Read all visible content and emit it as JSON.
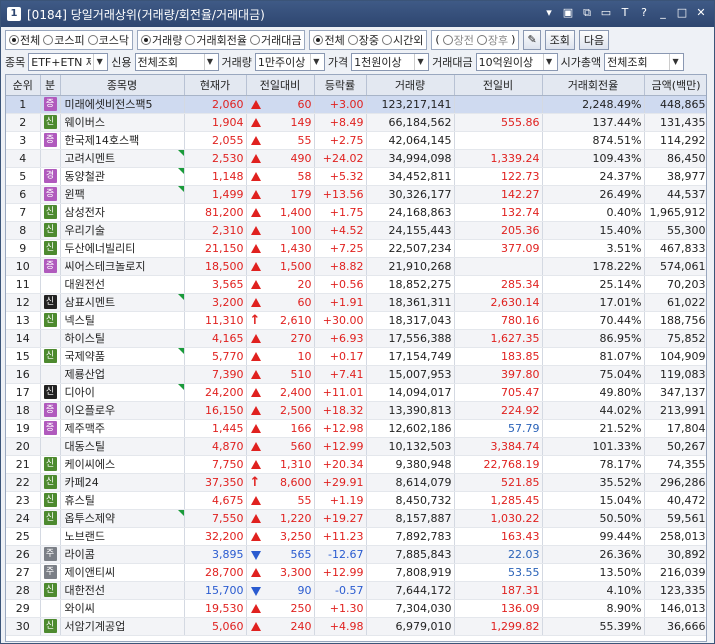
{
  "window": {
    "num": "1",
    "title": "[0184] 당일거래상위(거래량/회전율/거래대금)"
  },
  "toolbar": {
    "market": [
      "전체",
      "코스피",
      "코스닥"
    ],
    "market_sel": 0,
    "basis": [
      "거래량",
      "거래회전율",
      "거래대금"
    ],
    "basis_sel": 0,
    "session": [
      "전체",
      "장중",
      "시간외"
    ],
    "session_sel": 0,
    "timeopt": [
      "장전",
      "장후"
    ],
    "query_label": "조회",
    "next_label": "다음"
  },
  "filters": {
    "jongmok_label": "종목",
    "jongmok_val": "ETF+ETN 제",
    "credit_label": "신용",
    "credit_val": "전체조회",
    "volume_label": "거래량",
    "volume_val": "1만주이상",
    "price_label": "가격",
    "price_val": "1천원이상",
    "amount_label": "거래대금",
    "amount_val": "10억원이상",
    "cap_label": "시가총액",
    "cap_val": "전체조회"
  },
  "columns": [
    "순위",
    "분",
    "종목명",
    "현재가",
    "전일대비",
    "등락률",
    "거래량",
    "전일비",
    "거래회전율",
    "금액(백만)"
  ],
  "rows": [
    {
      "rank": "1",
      "badge": "증",
      "bt": "gyeong",
      "name": "미래에셋비전스팩5",
      "price": "2,060",
      "dir": "up",
      "change": "60",
      "rate": "+3.00",
      "vol": "123,217,141",
      "prev": "",
      "turn": "2,248.49%",
      "amt": "448,865",
      "flag": false,
      "hl": true
    },
    {
      "rank": "2",
      "badge": "신",
      "bt": "sin",
      "name": "웨이버스",
      "price": "1,904",
      "dir": "up",
      "change": "149",
      "rate": "+8.49",
      "vol": "66,184,562",
      "prev": "555.86",
      "turn": "137.44%",
      "amt": "131,435",
      "flag": false
    },
    {
      "rank": "3",
      "badge": "증",
      "bt": "gyeong",
      "name": "한국제14호스팩",
      "price": "2,055",
      "dir": "up",
      "change": "55",
      "rate": "+2.75",
      "vol": "42,064,145",
      "prev": "",
      "turn": "874.51%",
      "amt": "114,292",
      "flag": false
    },
    {
      "rank": "4",
      "badge": "",
      "bt": "",
      "name": "고려시멘트",
      "price": "2,530",
      "dir": "up",
      "change": "490",
      "rate": "+24.02",
      "vol": "34,994,098",
      "prev": "1,339.24",
      "turn": "109.43%",
      "amt": "86,450",
      "flag": true
    },
    {
      "rank": "5",
      "badge": "경",
      "bt": "gyeong",
      "name": "동양철관",
      "price": "1,148",
      "dir": "up",
      "change": "58",
      "rate": "+5.32",
      "vol": "34,452,811",
      "prev": "122.73",
      "turn": "24.37%",
      "amt": "38,977",
      "flag": true
    },
    {
      "rank": "6",
      "badge": "증",
      "bt": "gyeong",
      "name": "윈팩",
      "price": "1,499",
      "dir": "up",
      "change": "179",
      "rate": "+13.56",
      "vol": "30,326,177",
      "prev": "142.27",
      "turn": "26.49%",
      "amt": "44,537",
      "flag": true
    },
    {
      "rank": "7",
      "badge": "신",
      "bt": "sin",
      "name": "삼성전자",
      "price": "81,200",
      "dir": "up",
      "change": "1,400",
      "rate": "+1.75",
      "vol": "24,168,863",
      "prev": "132.74",
      "turn": "0.40%",
      "amt": "1,965,912",
      "flag": false
    },
    {
      "rank": "8",
      "badge": "신",
      "bt": "sin",
      "name": "우리기술",
      "price": "2,310",
      "dir": "up",
      "change": "100",
      "rate": "+4.52",
      "vol": "24,155,443",
      "prev": "205.36",
      "turn": "15.40%",
      "amt": "55,300",
      "flag": false
    },
    {
      "rank": "9",
      "badge": "신",
      "bt": "sin",
      "name": "두산에너빌리티",
      "price": "21,150",
      "dir": "up",
      "change": "1,430",
      "rate": "+7.25",
      "vol": "22,507,234",
      "prev": "377.09",
      "turn": "3.51%",
      "amt": "467,833",
      "flag": false
    },
    {
      "rank": "10",
      "badge": "증",
      "bt": "gyeong",
      "name": "씨어스테크놀로지",
      "price": "18,500",
      "dir": "up",
      "change": "1,500",
      "rate": "+8.82",
      "vol": "21,910,268",
      "prev": "",
      "turn": "178.22%",
      "amt": "574,061",
      "flag": false
    },
    {
      "rank": "11",
      "badge": "",
      "bt": "",
      "name": "대원전선",
      "price": "3,565",
      "dir": "up",
      "change": "20",
      "rate": "+0.56",
      "vol": "18,852,275",
      "prev": "285.34",
      "turn": "25.14%",
      "amt": "70,203",
      "flag": false
    },
    {
      "rank": "12",
      "badge": "신",
      "bt": "sinb",
      "name": "삼표시멘트",
      "price": "3,200",
      "dir": "up",
      "change": "60",
      "rate": "+1.91",
      "vol": "18,361,311",
      "prev": "2,630.14",
      "turn": "17.01%",
      "amt": "61,022",
      "flag": true
    },
    {
      "rank": "13",
      "badge": "신",
      "bt": "sin",
      "name": "넥스틸",
      "price": "11,310",
      "dir": "upper",
      "change": "2,610",
      "rate": "+30.00",
      "vol": "18,317,043",
      "prev": "780.16",
      "turn": "70.44%",
      "amt": "188,756",
      "flag": false
    },
    {
      "rank": "14",
      "badge": "",
      "bt": "",
      "name": "하이스틸",
      "price": "4,165",
      "dir": "up",
      "change": "270",
      "rate": "+6.93",
      "vol": "17,556,388",
      "prev": "1,627.35",
      "turn": "86.95%",
      "amt": "75,852",
      "flag": false
    },
    {
      "rank": "15",
      "badge": "신",
      "bt": "sin",
      "name": "국제약품",
      "price": "5,770",
      "dir": "up",
      "change": "10",
      "rate": "+0.17",
      "vol": "17,154,749",
      "prev": "183.85",
      "turn": "81.07%",
      "amt": "104,909",
      "flag": true
    },
    {
      "rank": "16",
      "badge": "",
      "bt": "",
      "name": "제룡산업",
      "price": "7,390",
      "dir": "up",
      "change": "510",
      "rate": "+7.41",
      "vol": "15,007,953",
      "prev": "397.80",
      "turn": "75.04%",
      "amt": "119,083",
      "flag": false
    },
    {
      "rank": "17",
      "badge": "신",
      "bt": "sinb",
      "name": "디아이",
      "price": "24,200",
      "dir": "up",
      "change": "2,400",
      "rate": "+11.01",
      "vol": "14,094,017",
      "prev": "705.47",
      "turn": "49.80%",
      "amt": "347,137",
      "flag": true
    },
    {
      "rank": "18",
      "badge": "증",
      "bt": "gyeong",
      "name": "이오플로우",
      "price": "16,150",
      "dir": "up",
      "change": "2,500",
      "rate": "+18.32",
      "vol": "13,390,813",
      "prev": "224.92",
      "turn": "44.02%",
      "amt": "213,991",
      "flag": false
    },
    {
      "rank": "19",
      "badge": "증",
      "bt": "gyeong",
      "name": "제주맥주",
      "price": "1,445",
      "dir": "up",
      "change": "166",
      "rate": "+12.98",
      "vol": "12,602,186",
      "prev": "57.79",
      "turn": "21.52%",
      "amt": "17,804",
      "flag": false,
      "prevblue": true
    },
    {
      "rank": "20",
      "badge": "",
      "bt": "",
      "name": "대동스틸",
      "price": "4,870",
      "dir": "up",
      "change": "560",
      "rate": "+12.99",
      "vol": "10,132,503",
      "prev": "3,384.74",
      "turn": "101.33%",
      "amt": "50,267",
      "flag": false
    },
    {
      "rank": "21",
      "badge": "신",
      "bt": "sin",
      "name": "케이씨에스",
      "price": "7,750",
      "dir": "up",
      "change": "1,310",
      "rate": "+20.34",
      "vol": "9,380,948",
      "prev": "22,768.19",
      "turn": "78.17%",
      "amt": "74,355",
      "flag": false
    },
    {
      "rank": "22",
      "badge": "신",
      "bt": "sin",
      "name": "카페24",
      "price": "37,350",
      "dir": "upper",
      "change": "8,600",
      "rate": "+29.91",
      "vol": "8,614,079",
      "prev": "521.85",
      "turn": "35.52%",
      "amt": "296,286",
      "flag": false
    },
    {
      "rank": "23",
      "badge": "신",
      "bt": "sin",
      "name": "휴스틸",
      "price": "4,675",
      "dir": "up",
      "change": "55",
      "rate": "+1.19",
      "vol": "8,450,732",
      "prev": "1,285.45",
      "turn": "15.04%",
      "amt": "40,472",
      "flag": false
    },
    {
      "rank": "24",
      "badge": "신",
      "bt": "sin",
      "name": "옵투스제약",
      "price": "7,550",
      "dir": "up",
      "change": "1,220",
      "rate": "+19.27",
      "vol": "8,157,887",
      "prev": "1,030.22",
      "turn": "50.50%",
      "amt": "59,561",
      "flag": true
    },
    {
      "rank": "25",
      "badge": "",
      "bt": "",
      "name": "노브랜드",
      "price": "32,200",
      "dir": "up",
      "change": "3,250",
      "rate": "+11.23",
      "vol": "7,892,783",
      "prev": "163.43",
      "turn": "99.44%",
      "amt": "258,013",
      "flag": false
    },
    {
      "rank": "26",
      "badge": "주",
      "bt": "ju",
      "name": "라이콤",
      "price": "3,895",
      "dir": "down",
      "change": "565",
      "rate": "-12.67",
      "vol": "7,885,843",
      "prev": "22.03",
      "turn": "26.36%",
      "amt": "30,892",
      "flag": false,
      "prevblue": true
    },
    {
      "rank": "27",
      "badge": "주",
      "bt": "ju",
      "name": "제이앤티씨",
      "price": "28,700",
      "dir": "up",
      "change": "3,300",
      "rate": "+12.99",
      "vol": "7,808,919",
      "prev": "53.55",
      "turn": "13.50%",
      "amt": "216,039",
      "flag": false,
      "prevblue": true
    },
    {
      "rank": "28",
      "badge": "신",
      "bt": "sin",
      "name": "대한전선",
      "price": "15,700",
      "dir": "down",
      "change": "90",
      "rate": "-0.57",
      "vol": "7,644,172",
      "prev": "187.31",
      "turn": "4.10%",
      "amt": "123,335",
      "flag": false
    },
    {
      "rank": "29",
      "badge": "",
      "bt": "",
      "name": "와이씨",
      "price": "19,530",
      "dir": "up",
      "change": "250",
      "rate": "+1.30",
      "vol": "7,304,030",
      "prev": "136.09",
      "turn": "8.90%",
      "amt": "146,013",
      "flag": false
    },
    {
      "rank": "30",
      "badge": "신",
      "bt": "sin",
      "name": "서암기계공업",
      "price": "5,060",
      "dir": "up",
      "change": "240",
      "rate": "+4.98",
      "vol": "6,979,010",
      "prev": "1,299.82",
      "turn": "55.39%",
      "amt": "36,666",
      "flag": false
    }
  ]
}
